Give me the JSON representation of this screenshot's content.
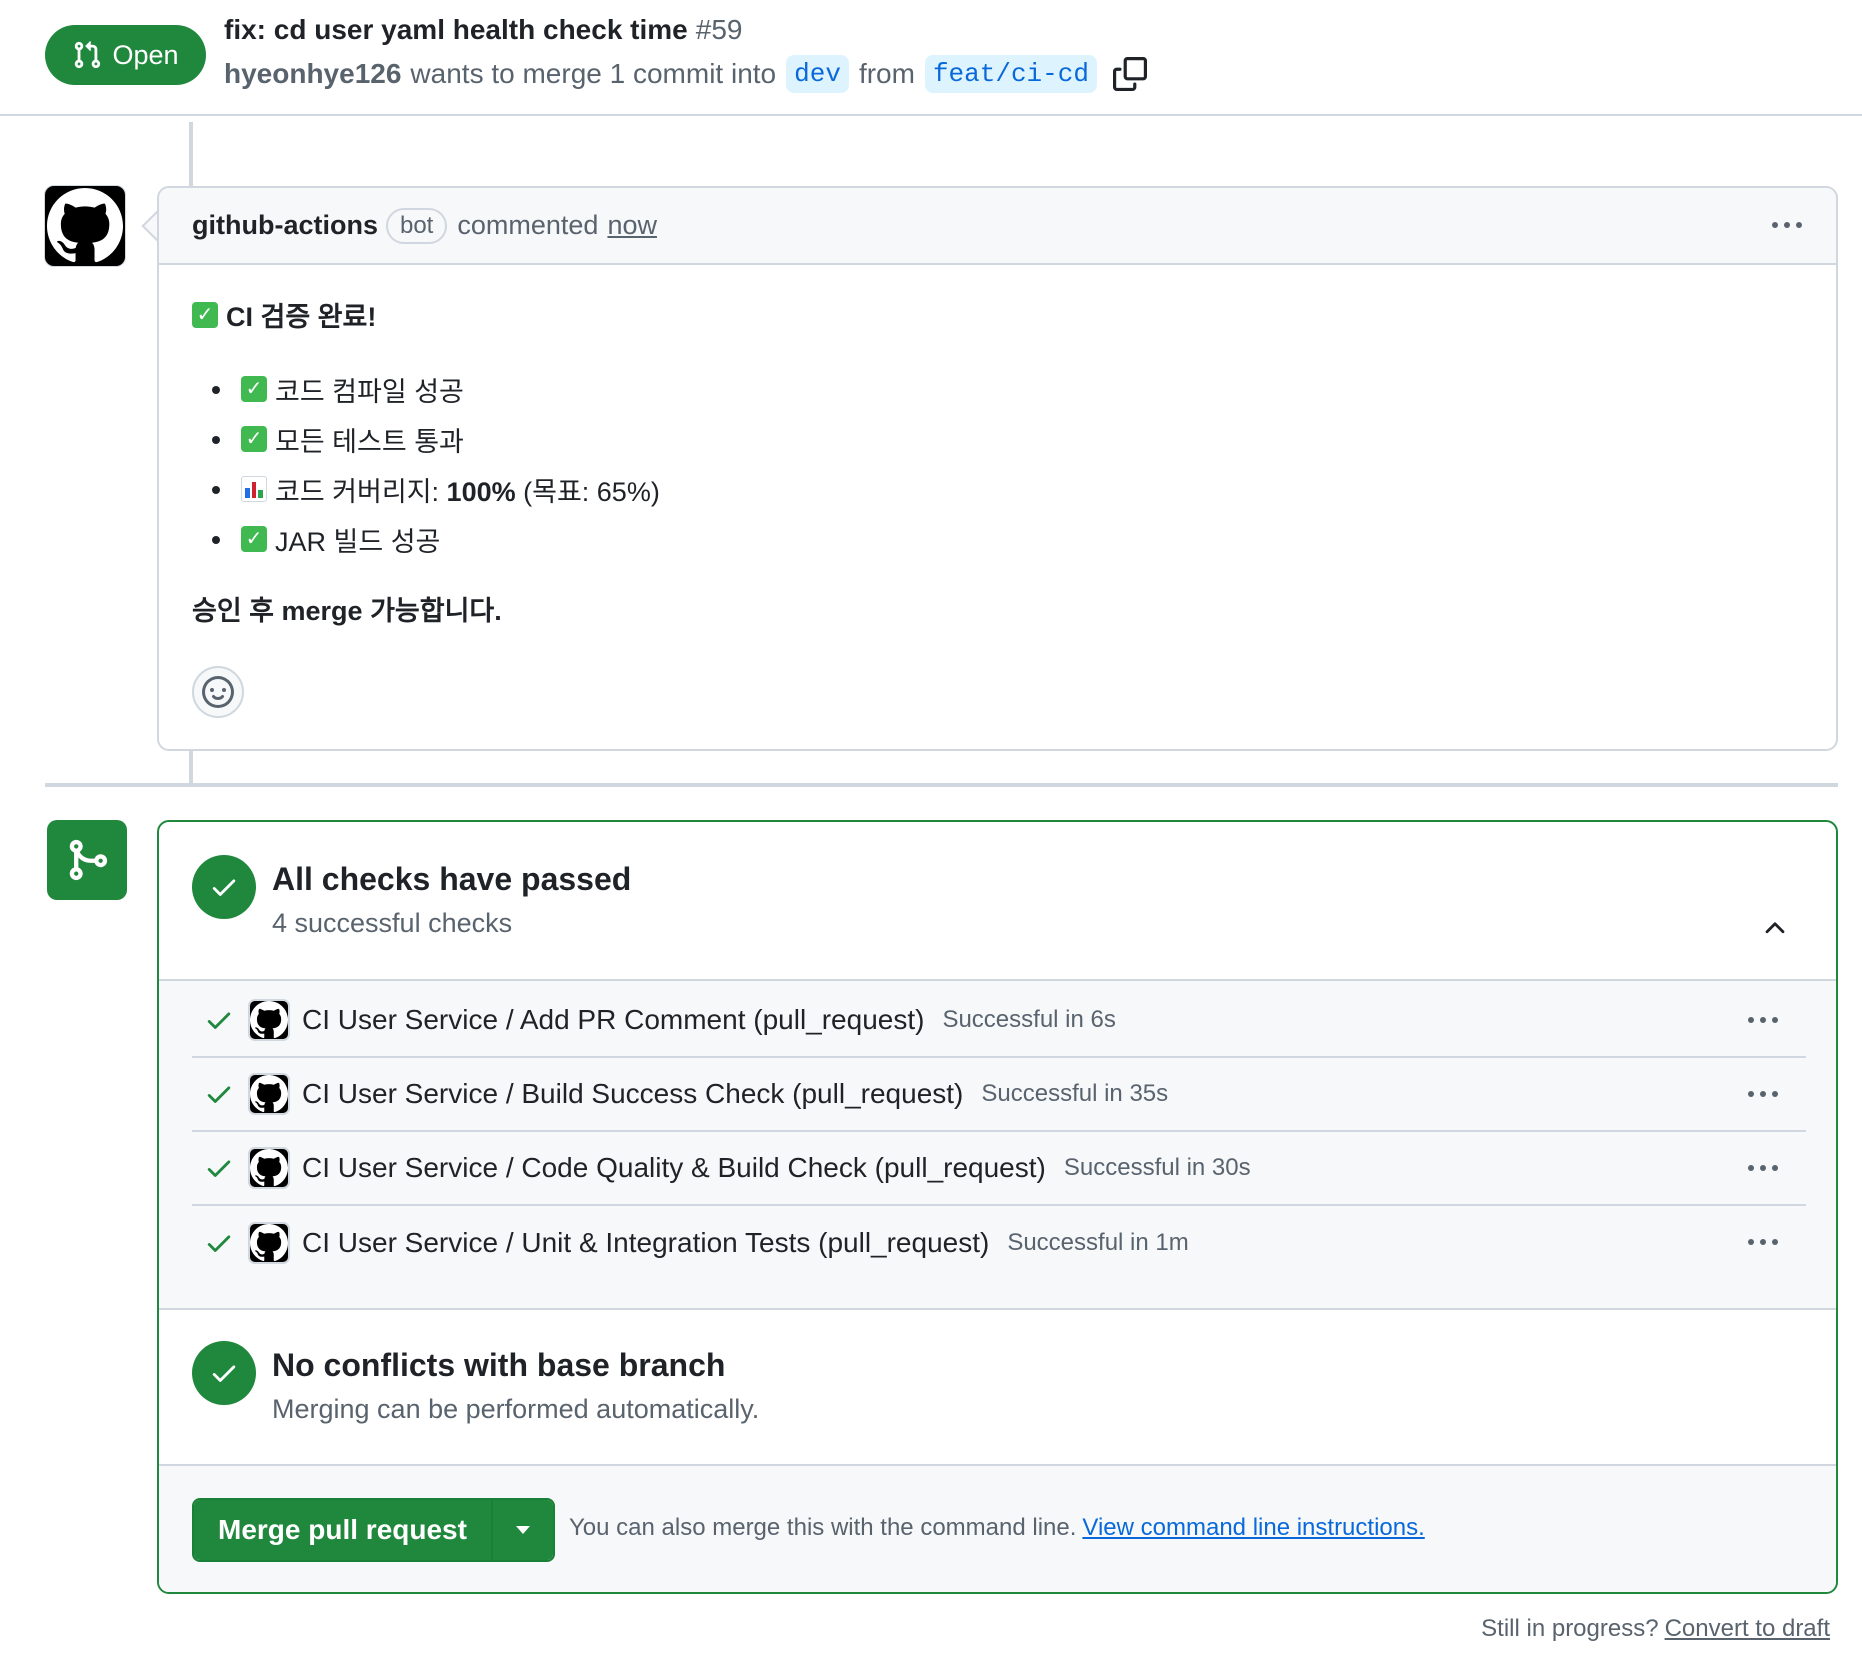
{
  "header": {
    "state_label": "Open",
    "title": "fix: cd user yaml health check time",
    "number": "#59",
    "author": "hyeonhye126",
    "merge_text": "wants to merge 1 commit into",
    "base_branch": "dev",
    "from_text": "from",
    "head_branch": "feat/ci-cd",
    "icons": {
      "state": "git-pull-request-icon",
      "copy": "copy-icon"
    }
  },
  "comment": {
    "author": "github-actions",
    "badge": "bot",
    "action": "commented",
    "time": "now",
    "body": {
      "title": "CI 검증 완료!",
      "items": [
        {
          "emoji": "check-mark-button",
          "text": "코드 컴파일 성공"
        },
        {
          "emoji": "check-mark-button",
          "text": "모든 테스트 통과"
        },
        {
          "emoji": "bar-chart",
          "text_before": "코드 커버리지: ",
          "text_bold": "100%",
          "text_after": " (목표: 65%)"
        },
        {
          "emoji": "check-mark-button",
          "text": "JAR 빌드 성공"
        }
      ],
      "final_normal": "승인 후 ",
      "final_bold": "merge 가능합니다."
    }
  },
  "checks": {
    "title": "All checks have passed",
    "subtitle": "4 successful checks",
    "items": [
      {
        "name": "CI User Service / Add PR Comment (pull_request)",
        "status": "Successful in 6s"
      },
      {
        "name": "CI User Service / Build Success Check (pull_request)",
        "status": "Successful in 35s"
      },
      {
        "name": "CI User Service / Code Quality & Build Check (pull_request)",
        "status": "Successful in 30s"
      },
      {
        "name": "CI User Service / Unit & Integration Tests (pull_request)",
        "status": "Successful in 1m"
      }
    ]
  },
  "conflicts": {
    "title": "No conflicts with base branch",
    "subtitle": "Merging can be performed automatically."
  },
  "merge": {
    "button_label": "Merge pull request",
    "hint": "You can also merge this with the command line.",
    "link": "View command line instructions."
  },
  "draft": {
    "question": "Still in progress?",
    "link": "Convert to draft"
  },
  "colors": {
    "success_green": "#1f883d",
    "link_blue": "#0969da",
    "muted_text": "#59636e",
    "border": "#d0d7de"
  }
}
